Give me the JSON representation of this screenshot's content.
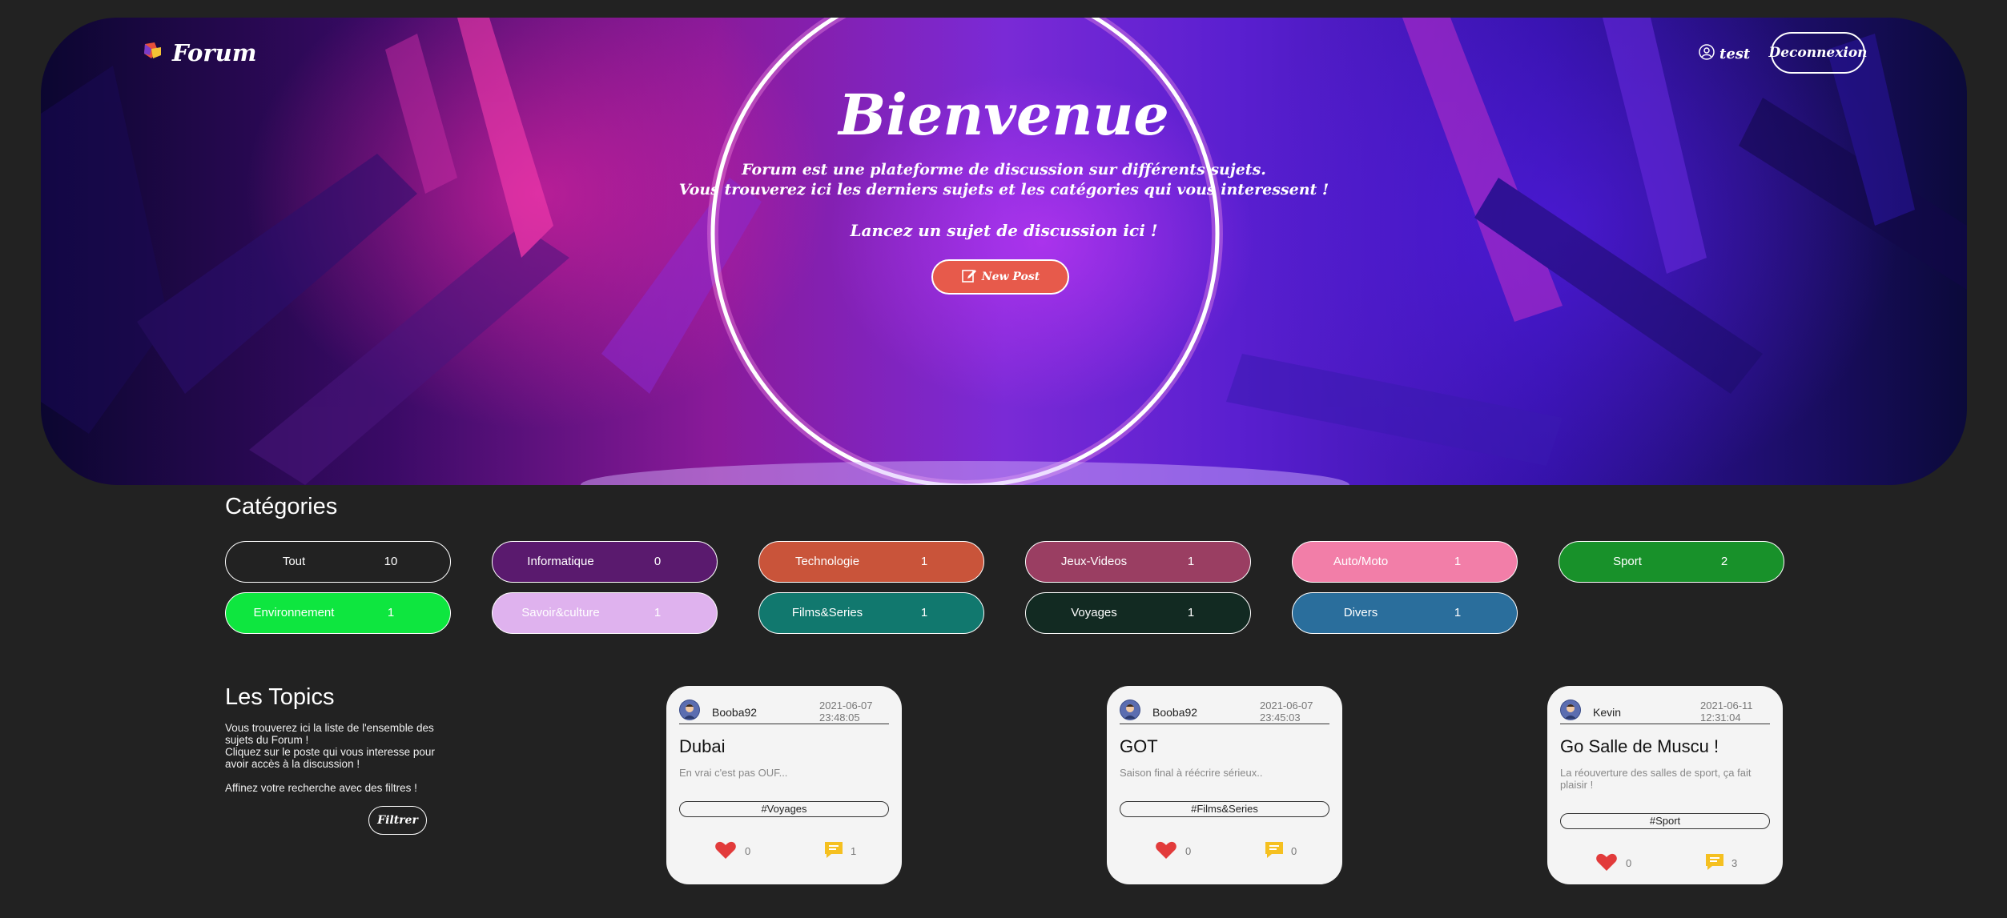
{
  "header": {
    "app_title": "Forum",
    "username": "test",
    "logout_label": "Deconnexion"
  },
  "hero": {
    "title": "Bienvenue",
    "intro_line1": "Forum est une plateforme de discussion sur différents sujets.",
    "intro_line2": "Vous trouverez ici les derniers sujets et les catégories qui vous interessent !",
    "cta": "Lancez un sujet de discussion ici !",
    "new_post_label": "New Post"
  },
  "categories": {
    "title": "Catégories",
    "items": [
      {
        "name": "Tout",
        "count": "10",
        "color": "#222222"
      },
      {
        "name": "Informatique",
        "count": "0",
        "color": "#5a1a6e"
      },
      {
        "name": "Technologie",
        "count": "1",
        "color": "#c9543a"
      },
      {
        "name": "Jeux-Videos",
        "count": "1",
        "color": "#9a3e62"
      },
      {
        "name": "Auto/Moto",
        "count": "1",
        "color": "#f27ea8"
      },
      {
        "name": "Sport",
        "count": "2",
        "color": "#18912a"
      },
      {
        "name": "Environnement",
        "count": "1",
        "color": "#0ee63f"
      },
      {
        "name": "Savoir&culture",
        "count": "1",
        "color": "#dfb2ee"
      },
      {
        "name": "Films&Series",
        "count": "1",
        "color": "#11786e"
      },
      {
        "name": "Voyages",
        "count": "1",
        "color": "#122a22"
      },
      {
        "name": "Divers",
        "count": "1",
        "color": "#2a6e9c"
      }
    ]
  },
  "topics": {
    "title": "Les Topics",
    "desc_line1": "Vous trouverez ici la liste de l'ensemble des sujets du Forum !",
    "desc_line2": "Cliquez sur le poste qui vous interesse pour avoir accès à la discussion !",
    "desc_line3": "Affinez votre recherche avec des filtres !",
    "filter_label": "Filtrer",
    "cards": [
      {
        "author": "Booba92",
        "date": "2021-06-07",
        "time": "23:48:05",
        "title": "Dubai",
        "excerpt": "En vrai c'est pas OUF...",
        "tag": "#Voyages",
        "likes": "0",
        "comments": "1"
      },
      {
        "author": "Booba92",
        "date": "2021-06-07",
        "time": "23:45:03",
        "title": "GOT",
        "excerpt": "Saison final à réécrire sérieux..",
        "tag": "#Films&Series",
        "likes": "0",
        "comments": "0"
      },
      {
        "author": "Kevin",
        "date": "2021-06-11",
        "time": "12:31:04",
        "title": "Go Salle de Muscu !",
        "excerpt": "La réouverture des salles de sport, ça fait plaisir !",
        "tag": "#Sport",
        "likes": "0",
        "comments": "3"
      }
    ]
  },
  "icons": {
    "logo": "forum-logo-icon",
    "user": "user-icon",
    "new_post": "edit-icon",
    "like": "heart-icon",
    "comment": "comment-icon",
    "avatar": "avatar-icon"
  }
}
